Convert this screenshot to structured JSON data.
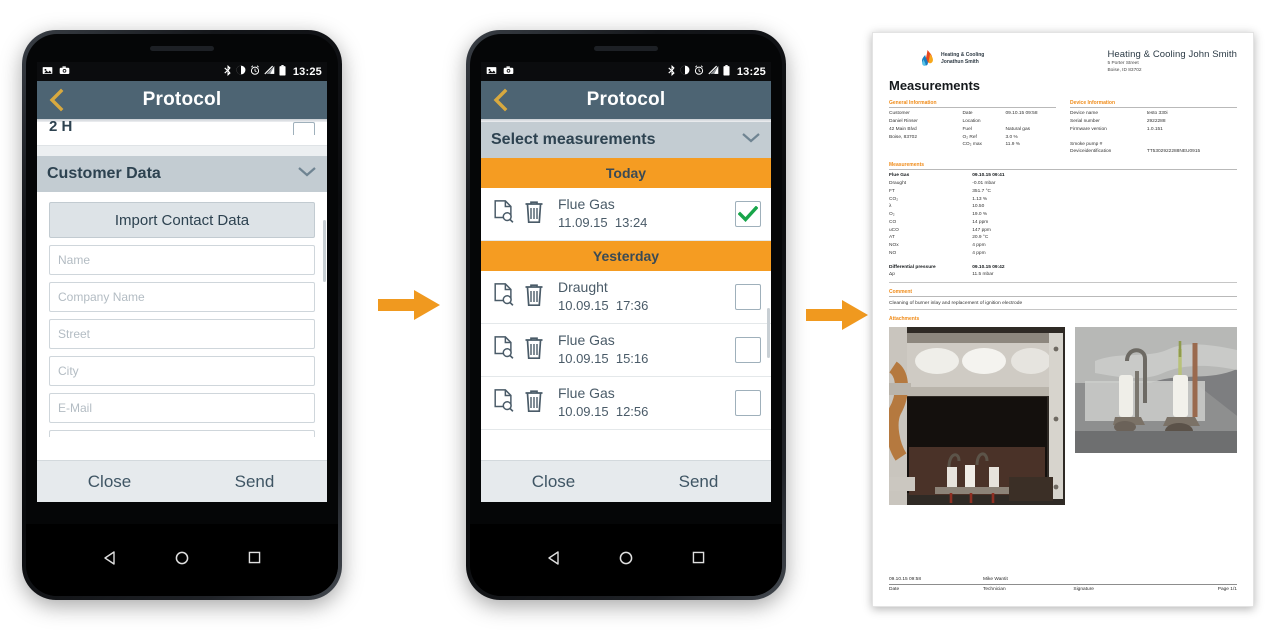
{
  "phone1": {
    "status": {
      "time": "13:25",
      "icons": [
        "image-icon",
        "camera-icon",
        "bluetooth-icon",
        "dnd-icon",
        "alarm-icon",
        "signal-icon",
        "battery-icon"
      ]
    },
    "appbar": {
      "title": "Protocol",
      "back_label": "Back"
    },
    "partial_row": {
      "label": "2 H"
    },
    "section": {
      "title": "Customer Data",
      "collapse_label": "Collapse"
    },
    "import_button": "Import Contact Data",
    "fields": [
      {
        "placeholder": "Name",
        "value": ""
      },
      {
        "placeholder": "Company Name",
        "value": ""
      },
      {
        "placeholder": "Street",
        "value": ""
      },
      {
        "placeholder": "City",
        "value": ""
      },
      {
        "placeholder": "E-Mail",
        "value": ""
      }
    ],
    "bottom": {
      "close": "Close",
      "send": "Send"
    }
  },
  "phone2": {
    "status": {
      "time": "13:25"
    },
    "appbar": {
      "title": "Protocol",
      "back_label": "Back"
    },
    "section": {
      "title": "Select measurements",
      "collapse_label": "Collapse"
    },
    "groups": [
      {
        "day": "Today",
        "rows": [
          {
            "name": "Flue Gas",
            "date": "11.09.15",
            "time": "13:24",
            "checked": true
          }
        ]
      },
      {
        "day": "Yesterday",
        "rows": [
          {
            "name": "Draught",
            "date": "10.09.15",
            "time": "17:36",
            "checked": false
          },
          {
            "name": "Flue Gas",
            "date": "10.09.15",
            "time": "15:16",
            "checked": false
          },
          {
            "name": "Flue Gas",
            "date": "10.09.15",
            "time": "12:56",
            "checked": false
          }
        ]
      }
    ],
    "bottom": {
      "close": "Close",
      "send": "Send"
    }
  },
  "arrows": {
    "count": 2,
    "color": "#f0991f",
    "label": "next-step-arrow"
  },
  "document": {
    "logo": {
      "line1": "Heating & Cooling",
      "line2": "Jonathun Smith"
    },
    "company": {
      "name": "Heating & Cooling John Smith",
      "street": "5 Porter Street",
      "city": "Boise, ID 83702"
    },
    "title": "Measurements",
    "general_information": {
      "label": "General Information",
      "left": [
        "Customer",
        "Daniel Rinser",
        "42 Main Blvd",
        "Boise, 83702"
      ],
      "rows": [
        {
          "k": "Date",
          "v": "09.10.15 09:58"
        },
        {
          "k": "Location",
          "v": ""
        },
        {
          "k": "Fuel",
          "v": "Natural gas"
        },
        {
          "k": "O₂ Ref",
          "v": "3.0 %"
        },
        {
          "k": "CO₂ max",
          "v": "11.9 %"
        }
      ]
    },
    "device_information": {
      "label": "Device Information",
      "rows": [
        {
          "k": "Device name",
          "v": "testo 330i"
        },
        {
          "k": "Serial number",
          "v": "2922288"
        },
        {
          "k": "Firmware version",
          "v": "1.0.151"
        },
        {
          "k": "",
          "v": ""
        },
        {
          "k": "Smoke pump #",
          "v": ""
        },
        {
          "k": "Deviceidentification",
          "v": "TT5302922288NEU0915"
        }
      ]
    },
    "measurements": {
      "label": "Measurements",
      "header": {
        "k": "Flue Gas",
        "v": "09.10.15 09:41"
      },
      "rows": [
        {
          "k": "Draught",
          "v": "-0.01 mbar"
        },
        {
          "k": "FT",
          "v": "351.7 °C"
        },
        {
          "k": "CO₂",
          "v": "1.13 %"
        },
        {
          "k": "λ",
          "v": "10.50"
        },
        {
          "k": "O₂",
          "v": "19.0 %"
        },
        {
          "k": "CO",
          "v": "14 ppm"
        },
        {
          "k": "uCO",
          "v": "147 ppm"
        },
        {
          "k": "AT",
          "v": "20.9 °C"
        },
        {
          "k": "NOx",
          "v": "4 ppm"
        },
        {
          "k": "NO",
          "v": "4 ppm"
        }
      ],
      "second_header": {
        "k": "Differential pressure",
        "v": "09.10.15 09:42"
      },
      "second_rows": [
        {
          "k": "Δp",
          "v": "11.5 mbar"
        }
      ]
    },
    "comment": {
      "label": "Comment",
      "text": "Cleaning of burner inlay and replacement of ignition electrode"
    },
    "attachments": {
      "label": "Attachments",
      "photo1_alt": "burner-chamber-photo",
      "photo2_alt": "ignition-electrodes-photo"
    },
    "footer": {
      "date_value": "09.10.15 09:58",
      "technician_value": "Mike Wantit",
      "signature_value": "",
      "date_label": "Date",
      "technician_label": "Technician",
      "signature_label": "Signature",
      "page_label": "Page 1/1"
    }
  }
}
